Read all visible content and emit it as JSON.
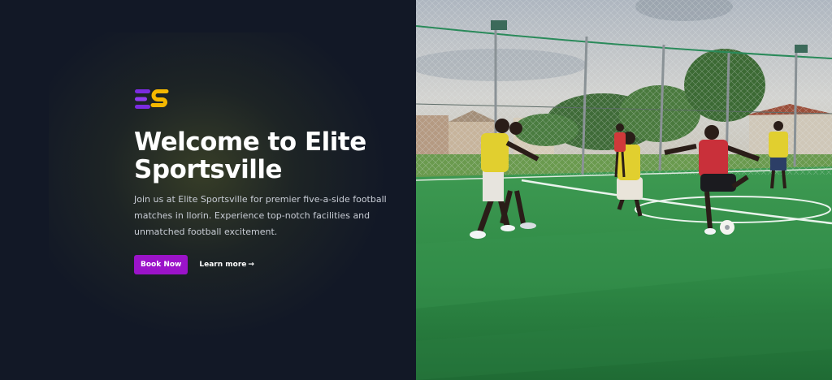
{
  "brand": {
    "logo_text": "ES",
    "logo_icon": "elite-sportsville-logo-icon"
  },
  "hero": {
    "title": "Welcome to Elite Sportsville",
    "description": "Join us at Elite Sportsville for premier five-a-side football matches in Ilorin. Experience top-notch facilities and unmatched football excitement.",
    "book_label": "Book Now",
    "learn_label": "Learn more",
    "learn_arrow": "→"
  },
  "colors": {
    "background": "#121826",
    "accent": "#9b13c9",
    "logo_purple": "#7b2be0",
    "logo_yellow": "#f5b800"
  },
  "image": {
    "alt": "Players in bibs playing five-a-side football on an artificial turf pitch"
  }
}
